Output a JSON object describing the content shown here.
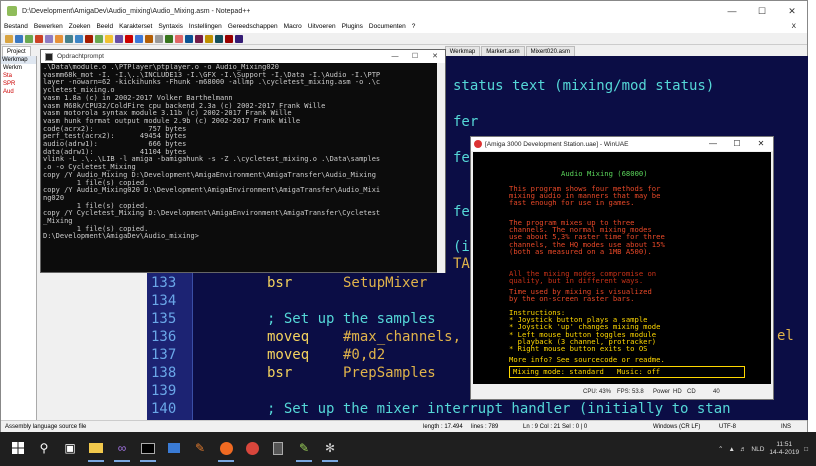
{
  "npp": {
    "title": "D:\\Development\\AmigaDev\\Audio_mixing\\Audio_Mixing.asm - Notepad++",
    "menu": [
      "Bestand",
      "Bewerken",
      "Zoeken",
      "Beeld",
      "Karakterset",
      "Syntaxis",
      "Instellingen",
      "Gereedschappen",
      "Macro",
      "Uitvoeren",
      "Plugins",
      "Documenten",
      "?"
    ],
    "menu_close": "X",
    "tabs": [
      "Project",
      "Werkmap",
      "Markert.asm",
      "Mixert020.asm"
    ],
    "project_header": "Werkmap",
    "project_items": [
      "Werkm",
      "Sta",
      "SPR",
      "Aud"
    ],
    "status": {
      "filetype": "Assembly language source file",
      "length": "length : 17.494",
      "lines": "lines : 789",
      "pos": "Ln : 9   Col : 21   Sel : 0 | 0",
      "eol": "Windows (CR LF)",
      "enc": "UTF-8",
      "ins": "INS"
    }
  },
  "editor": {
    "background_lines": [
      {
        "text": "status text (mixing/mod status)",
        "cls": "c-cmt"
      },
      {
        "text": "fer",
        "cls": "c-cmt"
      },
      {
        "text": "fer",
        "cls": "c-cmt"
      },
      {
        "text": "fer",
        "cls": "c-cmt"
      },
      {
        "text": "(in",
        "cls": "c-cmt"
      },
      {
        "text": "TAN",
        "cls": "c-op"
      },
      {
        "text": "el",
        "cls": "c-op"
      }
    ],
    "lines": [
      {
        "num": "133",
        "ins": "bsr",
        "op": "SetupMixer",
        "cmt": ""
      },
      {
        "num": "134",
        "ins": "",
        "op": "",
        "cmt": ""
      },
      {
        "num": "135",
        "ins": "",
        "op": "",
        "cmt": "; Set up the samples"
      },
      {
        "num": "136",
        "ins": "moveq",
        "op": "#max_channels,",
        "cmt": ""
      },
      {
        "num": "137",
        "ins": "moveq",
        "op": "#0,d2",
        "cmt": ""
      },
      {
        "num": "138",
        "ins": "bsr",
        "op": "PrepSamples",
        "cmt": ""
      },
      {
        "num": "139",
        "ins": "",
        "op": "",
        "cmt": ""
      },
      {
        "num": "140",
        "ins": "",
        "op": "",
        "cmt": "; Set up the mixer interrupt handler (initially to stan"
      }
    ]
  },
  "cmd": {
    "title": "Opdrachtprompt",
    "lines": [
      ".\\Data\\module.o .\\PTPlayer\\ptplayer.o -o Audio_Mixing020",
      "vasmm68k_mot -I. -I.\\..\\INCLUDE13 -I.\\GFX -I.\\Support -I.\\Data -I.\\Audio -I.\\PTP",
      "layer -nowarn=62 -kickihunks -Fhunk -m68000 -allmp .\\cycletest_mixing.asm -o .\\c",
      "ycletest_mixing.o",
      "vasm 1.8a (c) in 2002-2017 Volker Barthelmann",
      "vasm M68k/CPU32/ColdFire cpu backend 2.3a (c) 2002-2017 Frank Wille",
      "vasm motorola syntax module 3.11b (c) 2002-2017 Frank Wille",
      "vasm hunk format output module 2.9b (c) 2002-2017 Frank Wille",
      "",
      "code(acrx2):             757 bytes",
      "perf_test(acrx2):      49454 bytes",
      "audio(adrw1):            666 bytes",
      "data(adrw1):           41104 bytes",
      "vlink -L .\\..\\LIB -l amiga -bamigahunk -s -Z .\\cycletest_mixing.o .\\Data\\samples",
      ".o -o Cycletest_Mixing",
      "copy /Y Audio_Mixing D:\\Development\\AmigaEnvironment\\AmigaTransfer\\Audio_Mixing",
      "        1 file(s) copied.",
      "copy /Y Audio_Mixing020 D:\\Development\\AmigaEnvironment\\AmigaTransfer\\Audio_Mixi",
      "ng020",
      "        1 file(s) copied.",
      "copy /Y Cycletest_Mixing D:\\Development\\AmigaEnvironment\\AmigaTransfer\\Cycletest",
      "_Mixing",
      "        1 file(s) copied.",
      "",
      "D:\\Development\\AmigaDev\\Audio_mixing>"
    ]
  },
  "uae": {
    "title": "[Amiga 3000 Development Station.uae] - WinUAE",
    "screen": {
      "title": "Audio Mixing (68000)",
      "para1": [
        "This program shows four methods for",
        "mixing audio in manners that may be",
        "fast enough for use in games."
      ],
      "para2": [
        "The program mixes up to three",
        "channels. The normal mixing modes",
        "use about 5,3% raster time for three",
        "channels, the HQ modes use about 15%",
        "(both as measured on a 1MB A500)."
      ],
      "para3": [
        "All the mixing modes compromise on",
        "quality, but in different ways."
      ],
      "para4": [
        "Time used by mixing is visualized",
        "by the on-screen raster bars."
      ],
      "instructions": [
        "Instructions:",
        "* Joystick button plays a sample",
        "* Joystick 'up' changes mixing mode",
        "* Left mouse button toggles module",
        "  playback (3 channel, protracker)",
        "* Right mouse button exits to OS"
      ],
      "more": "More info? See sourcecode or readme.",
      "status_box": "Mixing mode: standard   Music: off"
    },
    "status": {
      "cpu": "CPU: 43%",
      "fps": "FPS: 53.8",
      "power": "Power",
      "hd": "HD",
      "cd": "CD",
      "num": "40"
    }
  },
  "taskbar": {
    "tray_lang": "NLD",
    "time": "11:51",
    "date": "14-4-2019"
  }
}
